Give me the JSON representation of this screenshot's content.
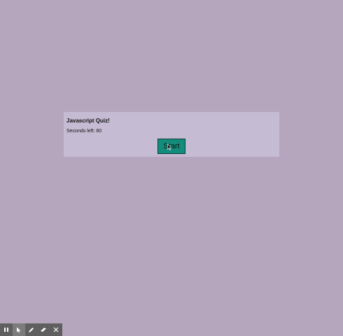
{
  "quiz": {
    "title": "Javascript Quiz!",
    "timer_label": "Seconds left: 60",
    "start_label": "Start"
  },
  "toolbar": {
    "tools": [
      {
        "name": "pause",
        "icon": "pause-icon",
        "active": false
      },
      {
        "name": "pointer",
        "icon": "pointer-icon",
        "active": true
      },
      {
        "name": "pen",
        "icon": "pen-icon",
        "active": false
      },
      {
        "name": "eraser",
        "icon": "eraser-icon",
        "active": false
      },
      {
        "name": "close",
        "icon": "close-icon",
        "active": false
      }
    ]
  },
  "colors": {
    "page_background": "#b5a6be",
    "card_background": "#c5bbd3",
    "button_background": "#148c7c",
    "toolbar_background": "#5f5f5f"
  }
}
